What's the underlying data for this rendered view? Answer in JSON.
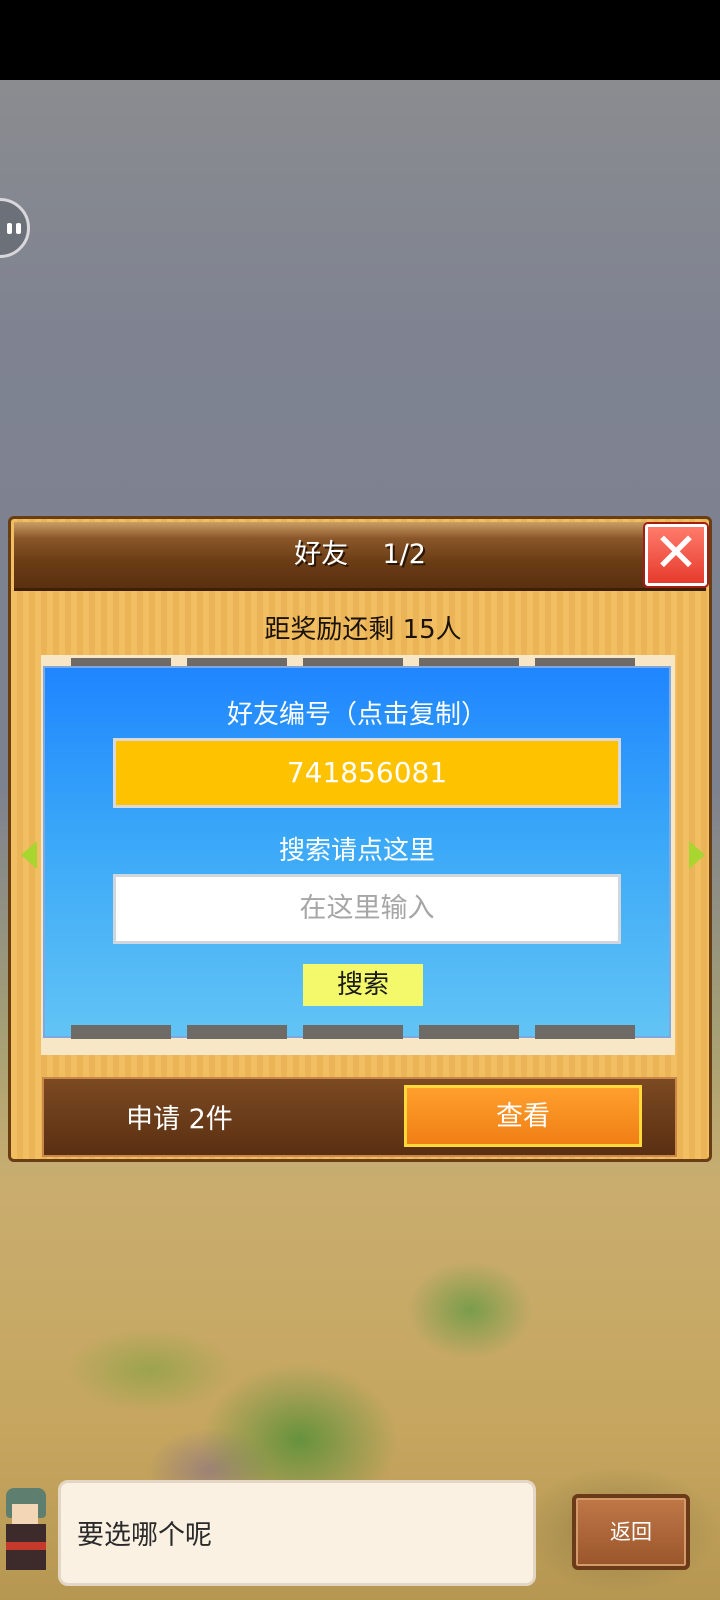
{
  "dialog": {
    "title": "好友    1/2",
    "close_icon": "✕",
    "reward_text": "距奖励还剩 15人"
  },
  "friend_panel": {
    "id_label": "好友编号（点击复制）",
    "friend_id": "741856081",
    "search_label": "搜索请点这里",
    "search_placeholder": "在这里输入",
    "search_button": "搜索"
  },
  "requests": {
    "text": "申请 2件",
    "view_button": "查看"
  },
  "bottom": {
    "speech": "要选哪个呢",
    "back_button": "返回"
  },
  "colors": {
    "panel_blue": "#1f86ff",
    "friend_id_bg": "#ffc200",
    "view_orange": "#f07f15",
    "close_red": "#e63b2c"
  }
}
